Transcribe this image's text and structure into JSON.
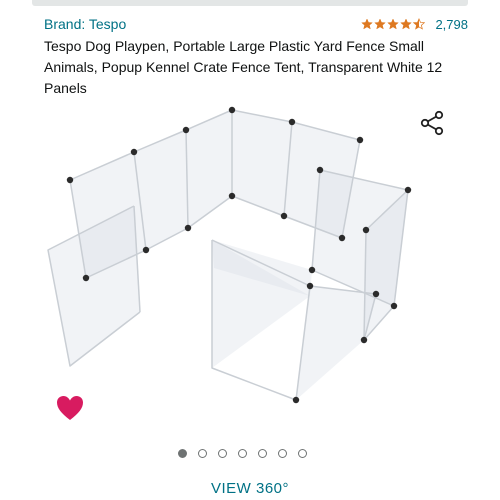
{
  "header": {
    "brand_label": "Brand: Tespo",
    "rating": 4.5,
    "review_count": "2,798",
    "title": "Tespo Dog Playpen, Portable Large Plastic Yard Fence Small Animals, Popup Kennel Crate Fence Tent, Transparent White 12 Panels"
  },
  "gallery": {
    "image_count": 7,
    "active_index": 0,
    "view_label": "VIEW 360°"
  },
  "colors": {
    "link": "#007185",
    "star": "#de7921",
    "heart": "#d81b60",
    "dot": "#6f7373"
  },
  "icons": [
    "star-icon",
    "share-icon",
    "heart-icon"
  ]
}
